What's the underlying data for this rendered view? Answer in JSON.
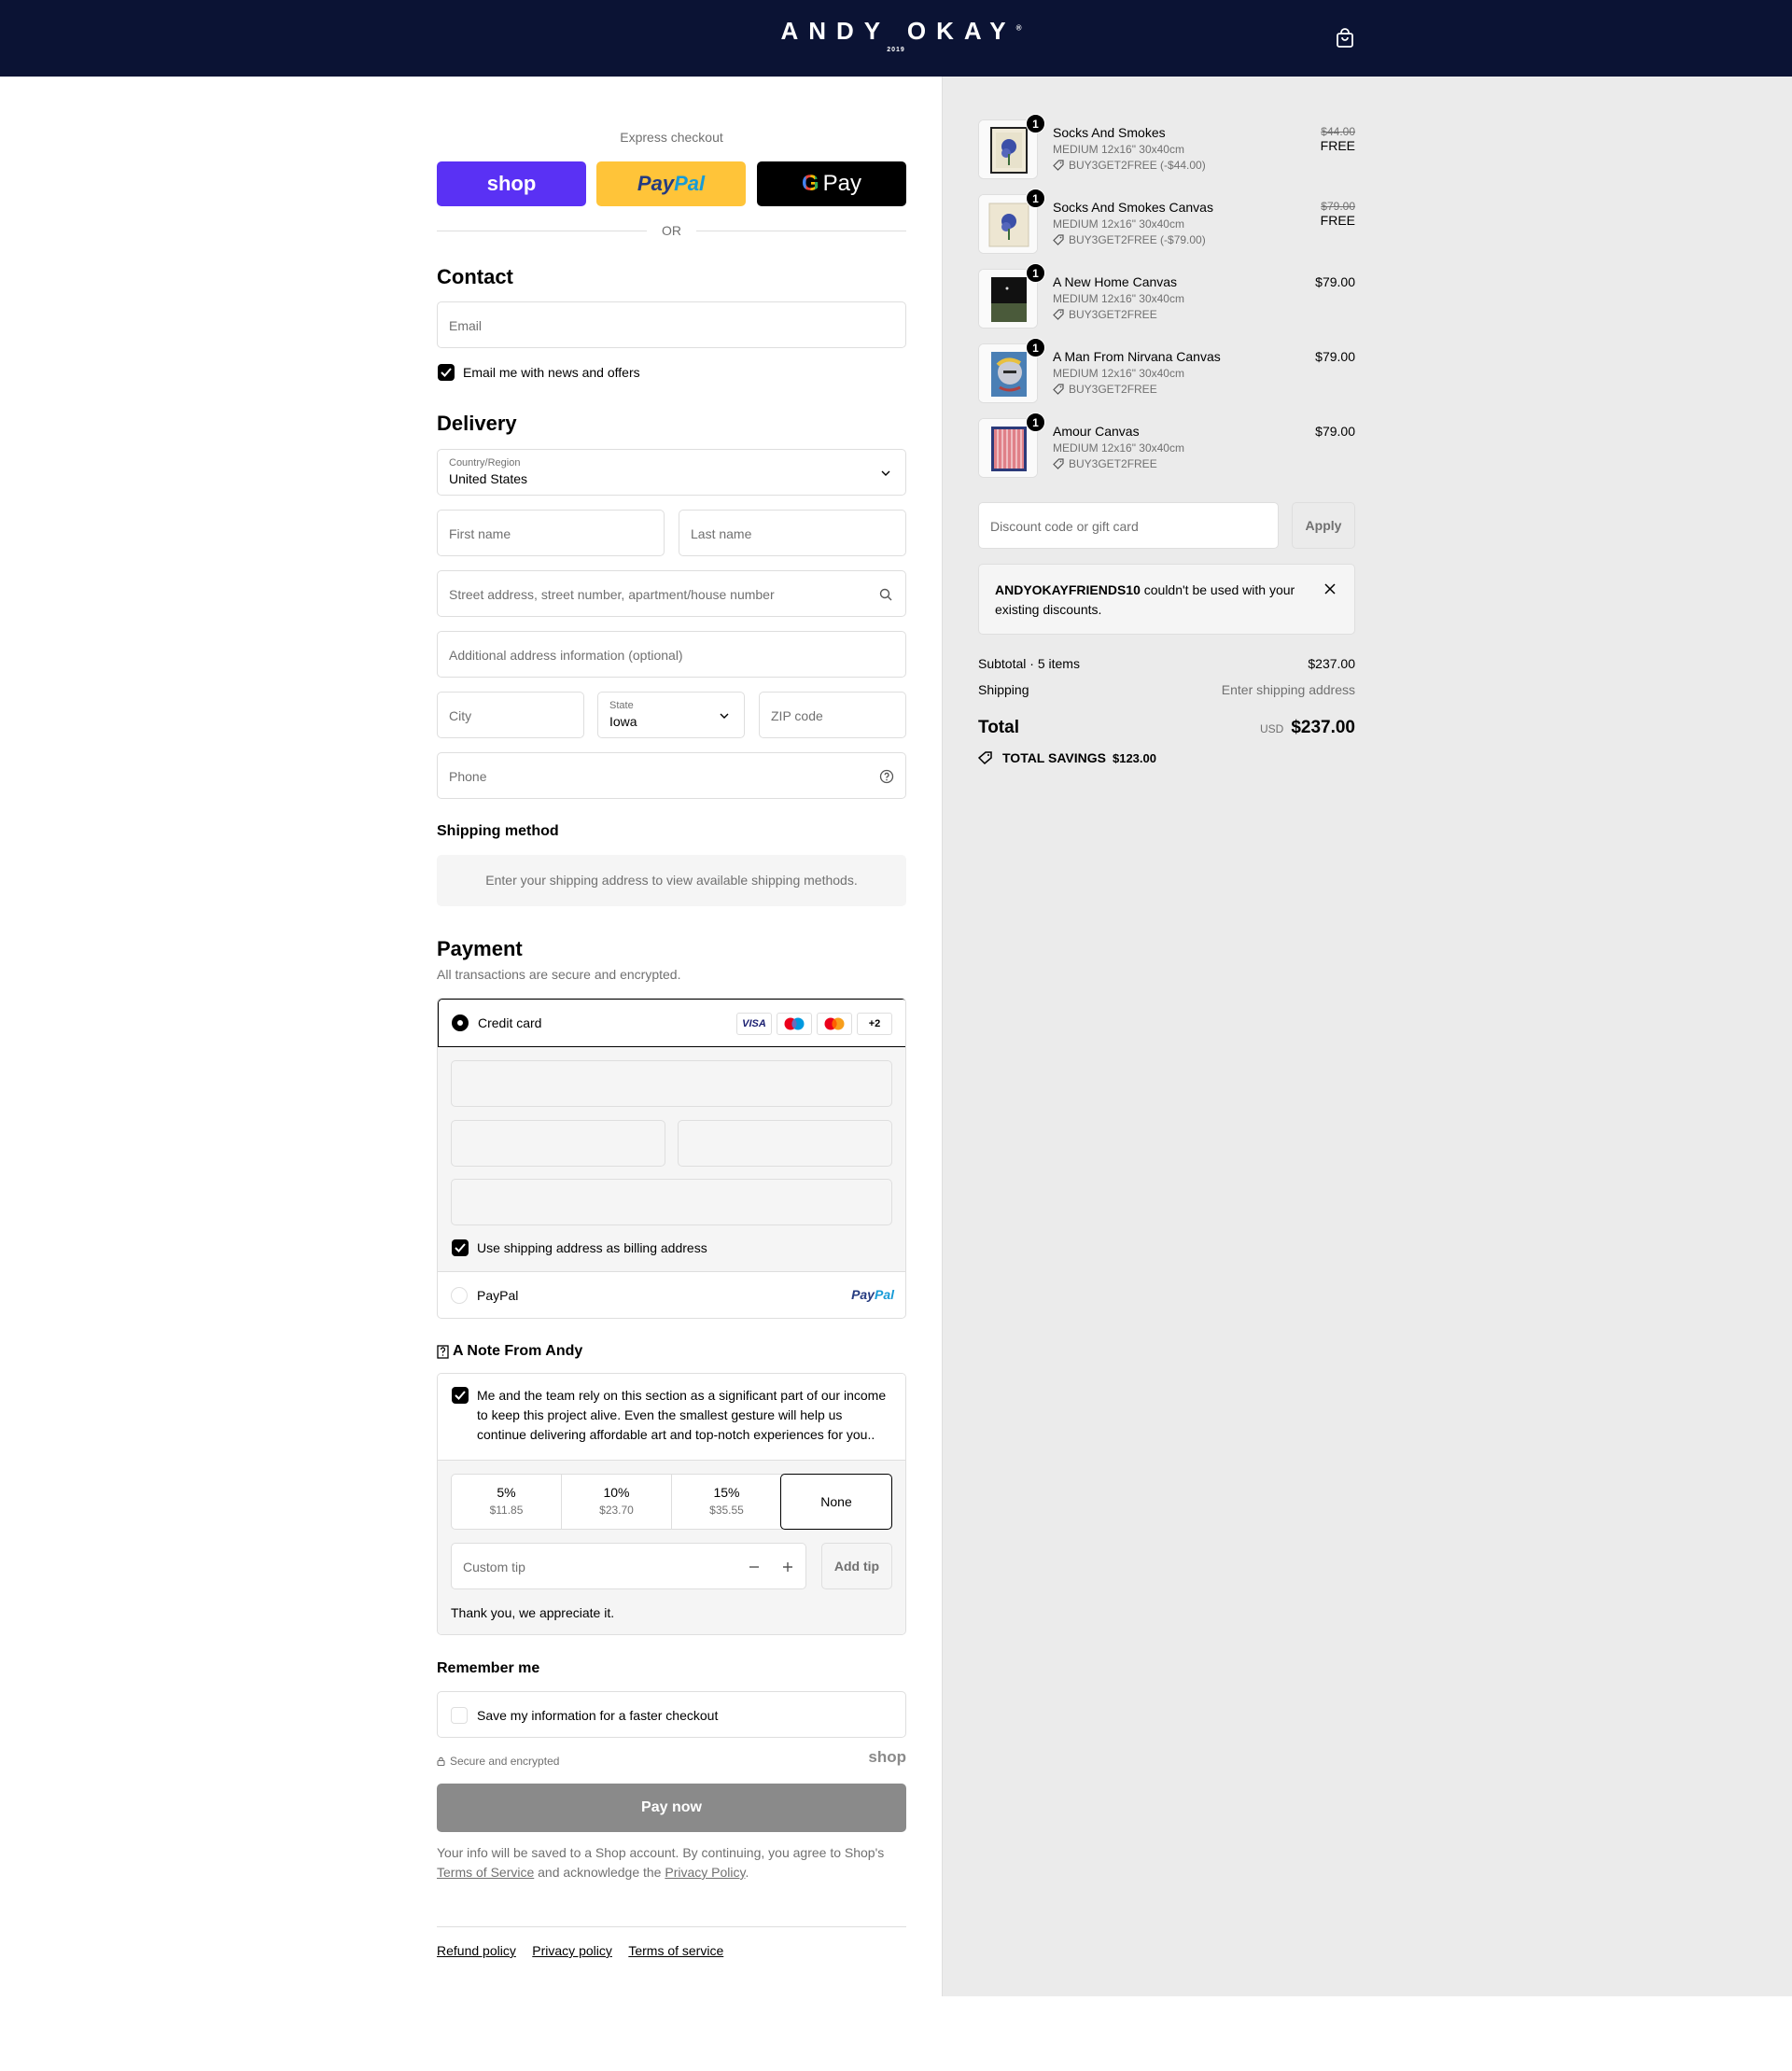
{
  "header": {
    "brand": "ANDY OKAY",
    "year": "2019"
  },
  "express": {
    "label": "Express checkout",
    "shop": "shop",
    "paypal_a": "Pay",
    "paypal_b": "Pal",
    "gpay_g": "G",
    "gpay_text": "Pay",
    "or": "OR"
  },
  "contact": {
    "title": "Contact",
    "email_placeholder": "Email",
    "news_label": "Email me with news and offers"
  },
  "delivery": {
    "title": "Delivery",
    "country_label": "Country/Region",
    "country_value": "United States",
    "first_name": "First name",
    "last_name": "Last name",
    "address": "Street address, street number, apartment/house number",
    "address2": "Additional address information (optional)",
    "city": "City",
    "state_label": "State",
    "state_value": "Iowa",
    "zip": "ZIP code",
    "phone": "Phone"
  },
  "shipping": {
    "title": "Shipping method",
    "message": "Enter your shipping address to view available shipping methods."
  },
  "payment": {
    "title": "Payment",
    "subtitle": "All transactions are secure and encrypted.",
    "credit_card": "Credit card",
    "cards": [
      "VISA",
      "maestro",
      "mastercard"
    ],
    "more_cards": "+2",
    "billing_label": "Use shipping address as billing address",
    "paypal": "PayPal",
    "paypal_logo_a": "Pay",
    "paypal_logo_b": "Pal"
  },
  "note": {
    "title": "A Note From Andy",
    "message": "Me and the team rely on this section as a significant part of our income to keep this project alive. Even the smallest gesture will help us continue delivering affordable art and top-notch experiences for you..",
    "tips": [
      {
        "percent": "5%",
        "amount": "$11.85"
      },
      {
        "percent": "10%",
        "amount": "$23.70"
      },
      {
        "percent": "15%",
        "amount": "$35.55"
      }
    ],
    "none": "None",
    "custom_placeholder": "Custom tip",
    "add_tip": "Add tip",
    "thanks": "Thank you, we appreciate it."
  },
  "remember": {
    "title": "Remember me",
    "save_label": "Save my information for a faster checkout",
    "secure": "Secure and encrypted",
    "shop_logo": "shop"
  },
  "pay_now": "Pay now",
  "legal": {
    "text1": "Your info will be saved to a Shop account. By continuing, you agree to Shop's",
    "tos": "Terms of Service",
    "text2": "and acknowledge the",
    "privacy": "Privacy Policy",
    "end": "."
  },
  "footer": {
    "refund": "Refund policy",
    "privacy": "Privacy policy",
    "terms": "Terms of service"
  },
  "items": [
    {
      "qty": "1",
      "name": "Socks And Smokes",
      "variant": "MEDIUM 12x16\" 30x40cm",
      "discount": "BUY3GET2FREE (-$44.00)",
      "old_price": "$44.00",
      "price": "FREE"
    },
    {
      "qty": "1",
      "name": "Socks And Smokes Canvas",
      "variant": "MEDIUM 12x16\" 30x40cm",
      "discount": "BUY3GET2FREE (-$79.00)",
      "old_price": "$79.00",
      "price": "FREE"
    },
    {
      "qty": "1",
      "name": "A New Home Canvas",
      "variant": "MEDIUM 12x16\" 30x40cm",
      "discount": "BUY3GET2FREE",
      "old_price": "",
      "price": "$79.00"
    },
    {
      "qty": "1",
      "name": "A Man From Nirvana Canvas",
      "variant": "MEDIUM 12x16\" 30x40cm",
      "discount": "BUY3GET2FREE",
      "old_price": "",
      "price": "$79.00"
    },
    {
      "qty": "1",
      "name": "Amour Canvas",
      "variant": "MEDIUM 12x16\" 30x40cm",
      "discount": "BUY3GET2FREE",
      "old_price": "",
      "price": "$79.00"
    }
  ],
  "discount": {
    "placeholder": "Discount code or gift card",
    "apply": "Apply",
    "error_code": "ANDYOKAYFRIENDS10",
    "error_line1": "couldn't be used with your",
    "error_line2": "existing discounts."
  },
  "summary": {
    "subtotal_label": "Subtotal · 5 items",
    "subtotal_value": "$237.00",
    "shipping_label": "Shipping",
    "shipping_value": "Enter shipping address",
    "total_label": "Total",
    "currency": "USD",
    "total_value": "$237.00",
    "savings_label": "TOTAL SAVINGS",
    "savings_value": "$123.00"
  }
}
